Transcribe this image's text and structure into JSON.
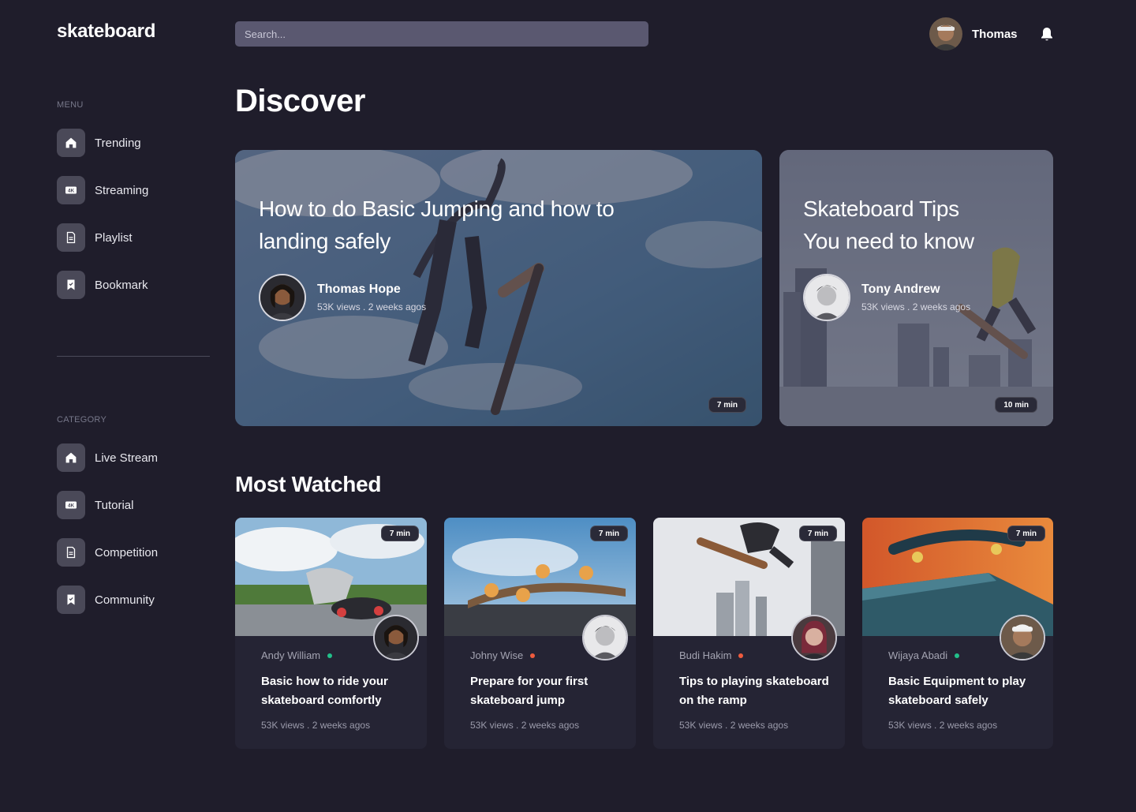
{
  "app": {
    "logo": "skateboard"
  },
  "header": {
    "search_placeholder": "Search...",
    "user_name": "Thomas"
  },
  "sidebar": {
    "menu_label": "MENU",
    "menu_items": [
      {
        "label": "Trending",
        "icon": "home-icon"
      },
      {
        "label": "Streaming",
        "icon": "4k-icon"
      },
      {
        "label": "Playlist",
        "icon": "document-icon"
      },
      {
        "label": "Bookmark",
        "icon": "bookmark-icon"
      }
    ],
    "category_label": "CATEGORY",
    "category_items": [
      {
        "label": "Live Stream",
        "icon": "home-icon"
      },
      {
        "label": "Tutorial",
        "icon": "4k-icon"
      },
      {
        "label": "Competition",
        "icon": "document-icon"
      },
      {
        "label": "Community",
        "icon": "bookmark-icon"
      }
    ]
  },
  "discover": {
    "title": "Discover",
    "featured": [
      {
        "title": "How to do Basic Jumping and how to landing safely",
        "author": "Thomas Hope",
        "meta": "53K views . 2 weeks agos",
        "duration": "7 min"
      },
      {
        "title": "Skateboard Tips You need to know",
        "author": "Tony Andrew",
        "meta": "53K views . 2 weeks agos",
        "duration": "10 min"
      }
    ]
  },
  "most_watched": {
    "title": "Most Watched",
    "cards": [
      {
        "author": "Andy William",
        "status_color": "#22c08a",
        "title": "Basic how to ride your skateboard comfortly",
        "meta": "53K views . 2 weeks agos",
        "duration": "7 min"
      },
      {
        "author": "Johny Wise",
        "status_color": "#ef5b3e",
        "title": "Prepare for your first skateboard jump",
        "meta": "53K views . 2 weeks agos",
        "duration": "7 min"
      },
      {
        "author": "Budi Hakim",
        "status_color": "#ef5b3e",
        "title": "Tips to playing skateboard on the ramp",
        "meta": "53K views . 2 weeks agos",
        "duration": "7 min"
      },
      {
        "author": "Wijaya Abadi",
        "status_color": "#22c08a",
        "title": "Basic Equipment to play skateboard safely",
        "meta": "53K views . 2 weeks agos",
        "duration": "7 min"
      }
    ]
  },
  "colors": {
    "background": "#1f1d2b",
    "card": "#252434",
    "nav_icon_bg": "#4a4958",
    "search_bg": "#5a5870",
    "online": "#22c08a",
    "offline": "#ef5b3e"
  }
}
